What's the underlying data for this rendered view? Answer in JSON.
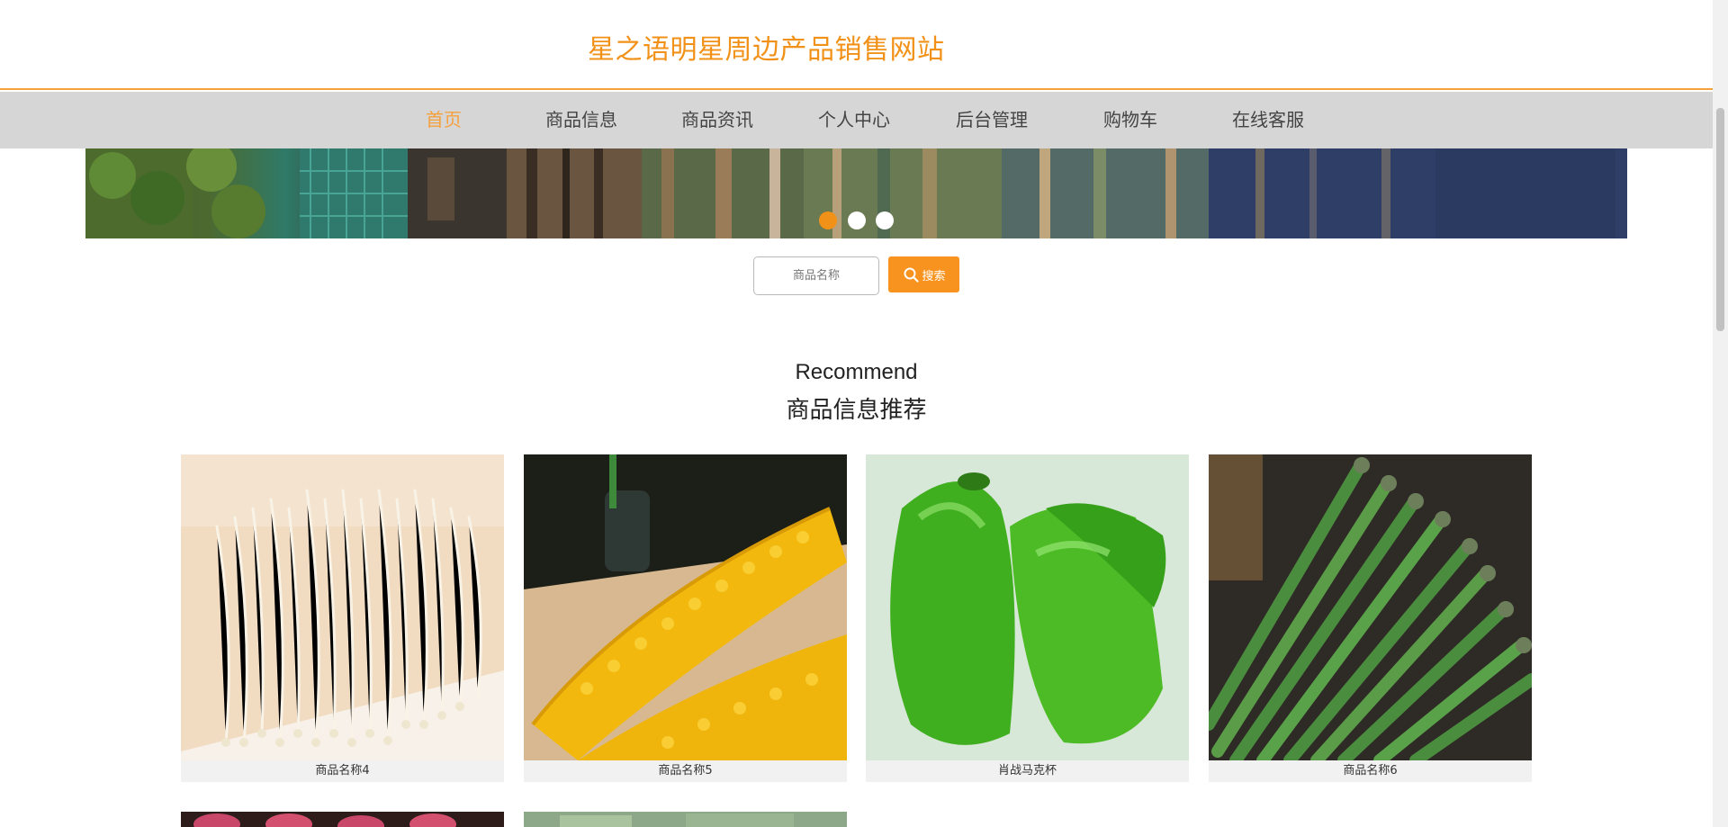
{
  "header": {
    "site_title": "星之语明星周边产品销售网站"
  },
  "nav": {
    "items": [
      {
        "label": "首页",
        "active": true
      },
      {
        "label": "商品信息",
        "active": false
      },
      {
        "label": "商品资讯",
        "active": false
      },
      {
        "label": "个人中心",
        "active": false
      },
      {
        "label": "后台管理",
        "active": false
      },
      {
        "label": "购物车",
        "active": false
      },
      {
        "label": "在线客服",
        "active": false
      }
    ]
  },
  "banner": {
    "slide_count": 3,
    "active_slide": 1
  },
  "search": {
    "placeholder": "商品名称",
    "value": "",
    "button_label": "搜索",
    "button_icon": "search-icon"
  },
  "recommend": {
    "title_en": "Recommend",
    "title_cn": "商品信息推荐",
    "products": [
      {
        "name": "商品名称4",
        "image": "enoki-mushroom-photo"
      },
      {
        "name": "商品名称5",
        "image": "corn-photo"
      },
      {
        "name": "肖战马克杯",
        "image": "green-pepper-photo"
      },
      {
        "name": "商品名称6",
        "image": "asparagus-photo"
      }
    ]
  },
  "colors": {
    "accent": "#f29118",
    "nav_bg": "#d6d6d6",
    "caption_bg": "#f1f1f1"
  }
}
